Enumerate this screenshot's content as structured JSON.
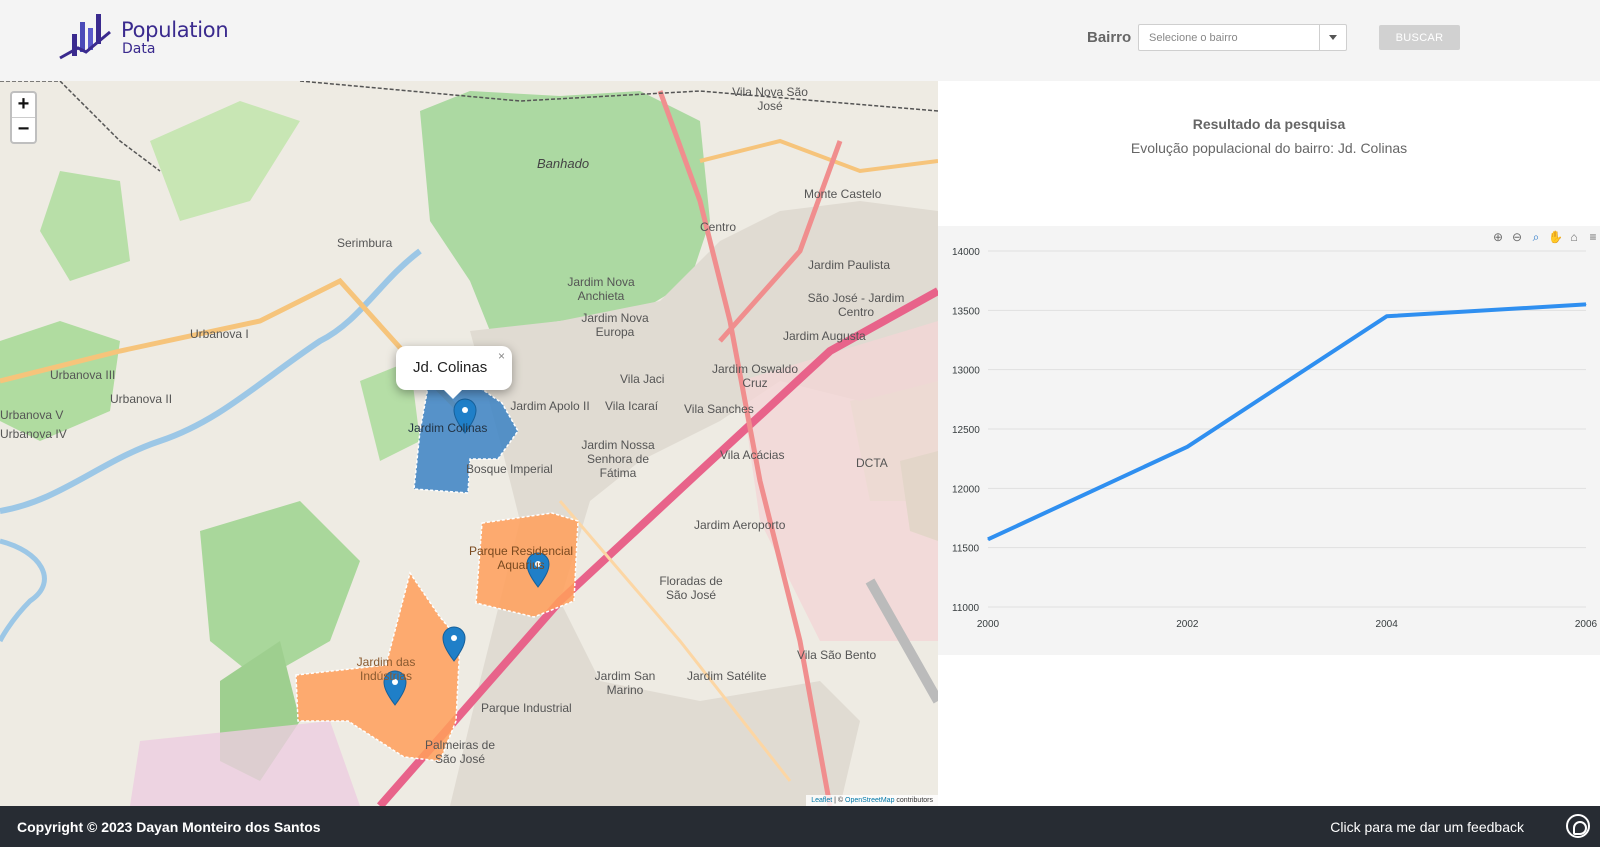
{
  "brand": {
    "title": "Population",
    "subtitle": "Data",
    "color": "#3a2a8e"
  },
  "search": {
    "label": "Bairro",
    "placeholder": "Selecione o bairro",
    "button": "BUSCAR"
  },
  "map": {
    "zoom_in": "+",
    "zoom_out": "−",
    "popup": {
      "text": "Jd. Colinas",
      "close": "×"
    },
    "attribution": {
      "leaflet": "Leaflet",
      "sep": " | © ",
      "osm": "OpenStreetMap",
      "tail": " contributors"
    },
    "labels": [
      "Banhado",
      "Vila Nova São José",
      "Monte Castelo",
      "Centro",
      "Serimbura",
      "Jardim Paulista",
      "São José - Jardim Centro",
      "Jardim Nova Anchieta",
      "Jardim Nova Europa",
      "Urbanova I",
      "Urbanova III",
      "Urbanova II",
      "Jardim Augusta",
      "Vila Jaci",
      "Jardim Oswaldo Cruz",
      "Jardim Apolo II",
      "Vila Icaraí",
      "Vila Sanches",
      "Jardim Colinas",
      "Jardim Nossa Senhora de Fátima",
      "Vila Acácias",
      "DCTA",
      "Bosque Imperial",
      "Jardim Aeroporto",
      "Parque Residencial Aquarius",
      "Floradas de São José",
      "Jardim Satélite",
      "Jardim San Marino",
      "Parque Industrial",
      "Vila São Bento",
      "Palmeiras de São José",
      "Jardim das Indústrias",
      "Urbanova V",
      "Urbanova IV"
    ],
    "colors": {
      "selected": "#3b82c4",
      "other": "#ff9f5a",
      "marker": "#1f7fc8"
    }
  },
  "result": {
    "title": "Resultado da pesquisa",
    "subtitle": "Evolução populacional do bairro: Jd. Colinas"
  },
  "toolbar": [
    "zoom-in-icon",
    "zoom-out-icon",
    "selection-zoom-icon",
    "pan-icon",
    "home-icon",
    "menu-icon"
  ],
  "chart_data": {
    "type": "line",
    "x": [
      2000,
      2002,
      2004,
      2006
    ],
    "series": [
      {
        "values": [
          11570,
          12350,
          13450,
          13550
        ]
      }
    ],
    "ylim": [
      11000,
      14000
    ],
    "yticks": [
      11000,
      11500,
      12000,
      12500,
      13000,
      13500,
      14000
    ],
    "xticks": [
      2000,
      2002,
      2004,
      2006
    ],
    "color": "#2f8ff0",
    "grid": true
  },
  "footer": {
    "copyright": "Copyright © 2023 Dayan Monteiro dos Santos",
    "feedback": "Click para me dar um feedback"
  }
}
